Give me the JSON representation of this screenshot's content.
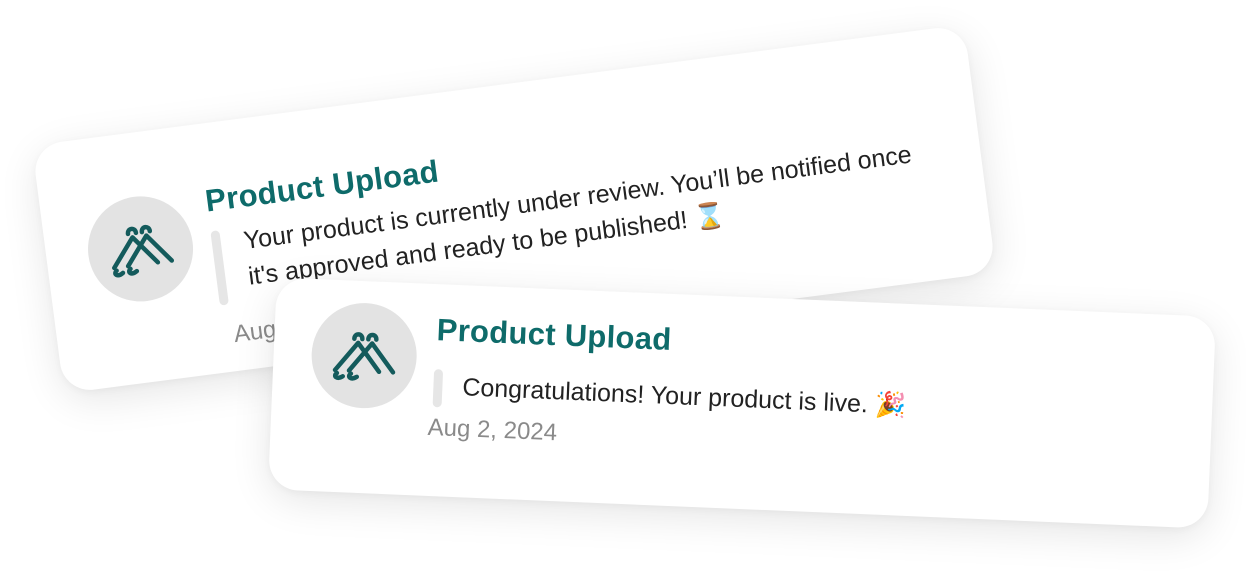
{
  "notifications": [
    {
      "title": "Product Upload",
      "message": "Your product is currently under review. You’ll be notified once it's approved and ready to be published! ⌛",
      "date": "Aug 2"
    },
    {
      "title": "Product Upload",
      "message": "Congratulations! Your product is live. 🎉",
      "date": "Aug 2, 2024"
    }
  ],
  "colors": {
    "accent": "#0e6b6a",
    "avatar_bg": "#e3e3e3",
    "muted_text": "#8a8a8a"
  },
  "icons": {
    "avatar_logo": "double-hanger-logo-icon"
  }
}
